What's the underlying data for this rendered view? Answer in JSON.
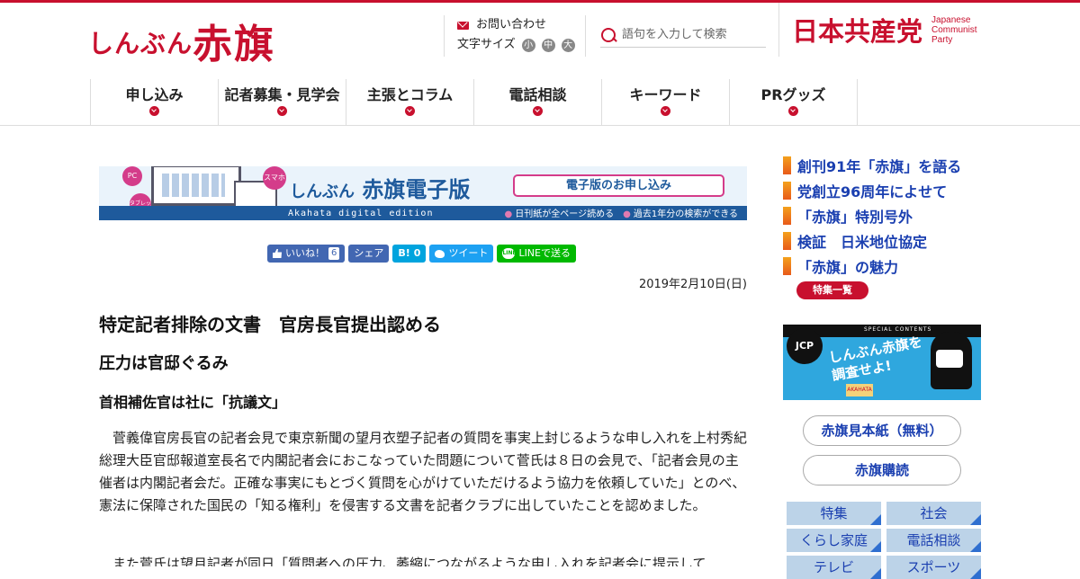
{
  "header": {
    "logo_small": "しんぶん",
    "logo_big": "赤旗",
    "contact_label": "お問い合わせ",
    "font_size_label": "文字サイズ",
    "font_sizes": [
      "小",
      "中",
      "大"
    ],
    "search_placeholder": "語句を入力して検索",
    "party_name": "日本共産党",
    "party_en_1": "Japanese",
    "party_en_2": "Communist",
    "party_en_3": "Party"
  },
  "nav": {
    "items": [
      {
        "label": "申し込み"
      },
      {
        "label": "記者募集・見学会"
      },
      {
        "label": "主張とコラム"
      },
      {
        "label": "電話相談"
      },
      {
        "label": "キーワード"
      },
      {
        "label": "PRグッズ"
      }
    ]
  },
  "banner": {
    "pc_badge": "PC",
    "tablet_badge": "タブレット",
    "phone_badge": "スマホ",
    "title_prefix": "しんぶん",
    "title": "赤旗電子版",
    "subtitle": "Akahata digital edition",
    "cta": "電子版のお申し込み",
    "bullet_1": "日刊紙が全ページ読める",
    "bullet_2": "過去1年分の検索ができる"
  },
  "share": {
    "like_label": "いいね！",
    "like_count": "6",
    "share_label": "シェア",
    "hatena_label": "B!",
    "hatena_count": "0",
    "tweet_label": "ツイート",
    "line_label": "LINEで送る",
    "line_icon_text": "LINE"
  },
  "article": {
    "date": "2019年2月10日(日)",
    "title": "特定記者排除の文書　官房長官提出認める",
    "subtitle_1": "圧力は官邸ぐるみ",
    "subtitle_2": "首相補佐官は社に「抗議文」",
    "paragraph_1": "菅義偉官房長官の記者会見で東京新聞の望月衣塑子記者の質問を事実上封じるような申し入れを上村秀紀総理大臣官邸報道室長名で内閣記者会におこなっていた問題について菅氏は８日の会見で、「記者会見の主催者は内閣記者会だ。正確な事実にもとづく質問を心がけていただけるよう協力を依頼していた」とのべ、憲法に保障された国民の「知る権利」を侵害する文書を記者クラブに出していたことを認めました。",
    "paragraph_2": "また菅氏は望月記者が同日「質問者への圧力、萎縮につながるような申し入れを記者会に提示して"
  },
  "sidebar": {
    "links": [
      {
        "label": "創刊91年「赤旗」を語る"
      },
      {
        "label": "党創立96周年によせて"
      },
      {
        "label": "「赤旗」特別号外"
      },
      {
        "label": "検証　日米地位協定"
      },
      {
        "label": "「赤旗」の魅力"
      }
    ],
    "feature_list_button": "特集一覧",
    "promo": {
      "badge": "JCP",
      "special": "SPECIAL CONTENTS",
      "text_1": "しんぶん赤旗を",
      "text_2": "調査せよ!",
      "tag": "AKAHATA"
    },
    "sample_button": "赤旗見本紙（無料）",
    "subscribe_button": "赤旗購読",
    "categories": [
      {
        "label": "特集"
      },
      {
        "label": "社会"
      },
      {
        "label": "くらし家庭"
      },
      {
        "label": "電話相談"
      },
      {
        "label": "テレビ"
      },
      {
        "label": "スポーツ"
      }
    ]
  },
  "colors": {
    "brand_red": "#c8102e",
    "link_blue": "#1a3fb0",
    "category_bg": "#bcd3e8"
  }
}
